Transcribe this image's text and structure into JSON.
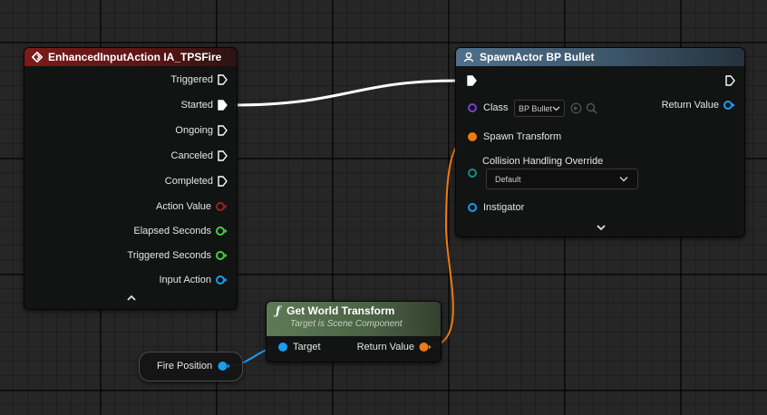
{
  "colors": {
    "exec": "#ffffff",
    "enhanced_input": "#8c1a1a",
    "float": "#3fd13f",
    "object": "#1a9cf0",
    "class": "#7a3fd6",
    "transform": "#ef7a10",
    "struct": "#1b8a8a",
    "action_value": "#9d1e1e"
  },
  "input_node": {
    "title": "EnhancedInputAction IA_TPSFire",
    "icon": "enhanced-input-icon",
    "pins": {
      "triggered": "Triggered",
      "started": "Started",
      "ongoing": "Ongoing",
      "canceled": "Canceled",
      "completed": "Completed",
      "action_value": "Action Value",
      "elapsed_seconds": "Elapsed Seconds",
      "triggered_seconds": "Triggered Seconds",
      "input_action": "Input Action"
    },
    "collapse_icon": "chevron-up-icon"
  },
  "spawn_node": {
    "title": "SpawnActor BP Bullet",
    "icon": "spawn-actor-icon",
    "class_label": "Class",
    "class_value": "BP Bullet",
    "return_value": "Return Value",
    "spawn_transform": "Spawn Transform",
    "collision_label": "Collision Handling Override",
    "collision_value": "Default",
    "instigator": "Instigator",
    "expand_icon": "chevron-down-icon"
  },
  "transform_node": {
    "title": "Get World Transform",
    "subtitle": "Target is Scene Component",
    "icon": "function-icon",
    "target": "Target",
    "return_value": "Return Value"
  },
  "variable_node": {
    "label": "Fire Position"
  }
}
